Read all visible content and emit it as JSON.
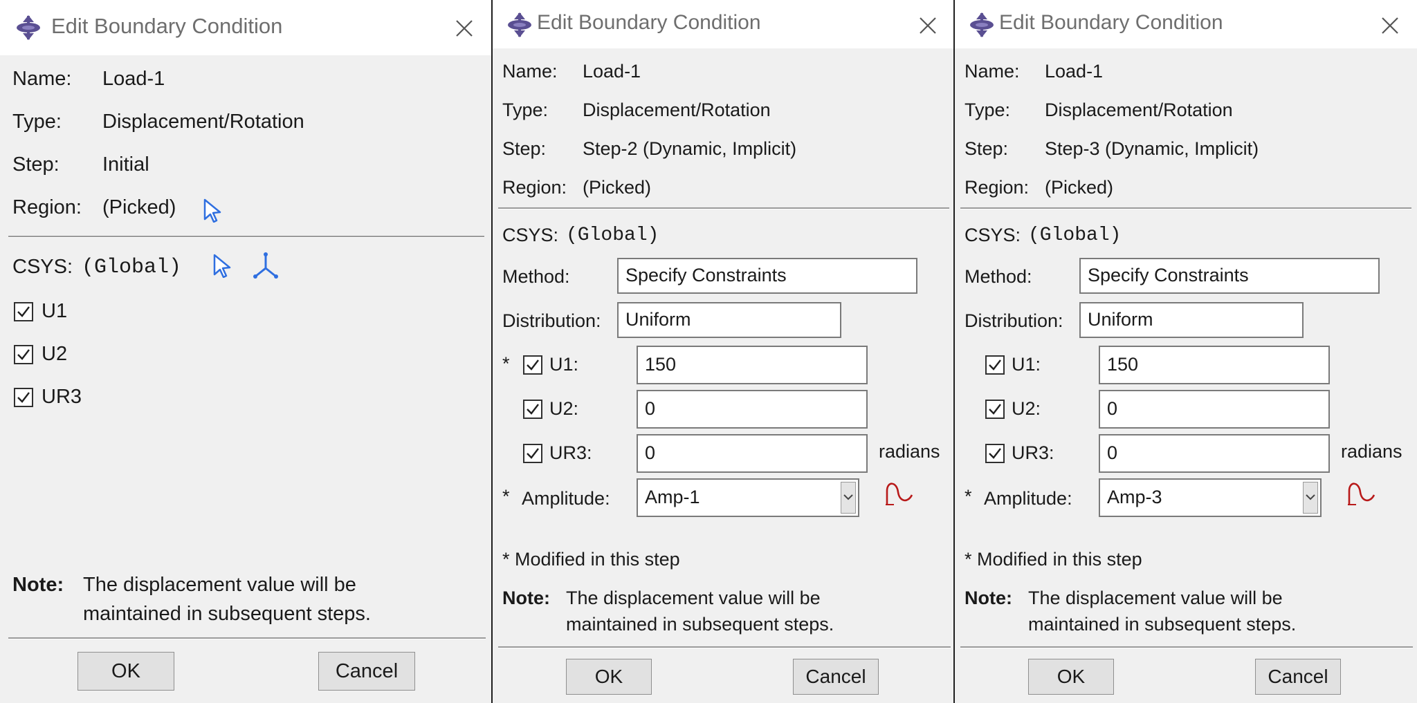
{
  "dialogs": [
    {
      "title": "Edit Boundary Condition",
      "name_label": "Name:",
      "name": "Load-1",
      "type_label": "Type:",
      "type": "Displacement/Rotation",
      "step_label": "Step:",
      "step": "Initial",
      "region_label": "Region:",
      "region": "(Picked)",
      "csys_label": "CSYS:",
      "csys": "(Global)",
      "dofs": [
        {
          "label": "U1",
          "checked": true
        },
        {
          "label": "U2",
          "checked": true
        },
        {
          "label": "UR3",
          "checked": true
        }
      ],
      "note_label": "Note:",
      "note_line1": "The displacement value will be",
      "note_line2": "maintained in subsequent steps.",
      "ok_label": "OK",
      "cancel_label": "Cancel"
    },
    {
      "title": "Edit Boundary Condition",
      "name_label": "Name:",
      "name": "Load-1",
      "type_label": "Type:",
      "type": "Displacement/Rotation",
      "step_label": "Step:",
      "step": "Step-2 (Dynamic, Implicit)",
      "region_label": "Region:",
      "region": "(Picked)",
      "csys_label": "CSYS:",
      "csys": "(Global)",
      "method_label": "Method:",
      "method": "Specify Constraints",
      "distribution_label": "Distribution:",
      "distribution": "Uniform",
      "dofs": [
        {
          "marker": "*",
          "label": "U1:",
          "value": "150",
          "checked": true
        },
        {
          "marker": "",
          "label": "U2:",
          "value": "0",
          "checked": true
        },
        {
          "marker": "",
          "label": "UR3:",
          "value": "0",
          "checked": true,
          "unit": "radians"
        }
      ],
      "amplitude_marker": "*",
      "amplitude_label": "Amplitude:",
      "amplitude": "Amp-1",
      "modified_note": "* Modified in this step",
      "note_label": "Note:",
      "note_line1": "The displacement value will be",
      "note_line2": "maintained in subsequent steps.",
      "ok_label": "OK",
      "cancel_label": "Cancel"
    },
    {
      "title": "Edit Boundary Condition",
      "name_label": "Name:",
      "name": "Load-1",
      "type_label": "Type:",
      "type": "Displacement/Rotation",
      "step_label": "Step:",
      "step": "Step-3 (Dynamic, Implicit)",
      "region_label": "Region:",
      "region": "(Picked)",
      "csys_label": "CSYS:",
      "csys": "(Global)",
      "method_label": "Method:",
      "method": "Specify Constraints",
      "distribution_label": "Distribution:",
      "distribution": "Uniform",
      "dofs": [
        {
          "marker": "",
          "label": "U1:",
          "value": "150",
          "checked": true
        },
        {
          "marker": "",
          "label": "U2:",
          "value": "0",
          "checked": true
        },
        {
          "marker": "",
          "label": "UR3:",
          "value": "0",
          "checked": true,
          "unit": "radians"
        }
      ],
      "amplitude_marker": "*",
      "amplitude_label": "Amplitude:",
      "amplitude": "Amp-3",
      "modified_note": "* Modified in this step",
      "note_label": "Note:",
      "note_line1": "The displacement value will be",
      "note_line2": "maintained in subsequent steps.",
      "ok_label": "OK",
      "cancel_label": "Cancel"
    }
  ],
  "colors": {
    "dialog_bg": "#f0f0f0",
    "titlebar_bg": "#ffffff",
    "title_text": "#6e6e6e",
    "picker_blue": "#2f6fe0",
    "amplitude_red": "#b81a1a",
    "app_icon_purple": "#5a4f92"
  },
  "icons": {
    "app": "abaqus-app-icon",
    "close": "close-icon",
    "pick": "pick-cursor-icon",
    "csys": "csys-axes-icon",
    "amplitude": "amplitude-curve-icon",
    "dropdown": "chevron-down-icon"
  }
}
